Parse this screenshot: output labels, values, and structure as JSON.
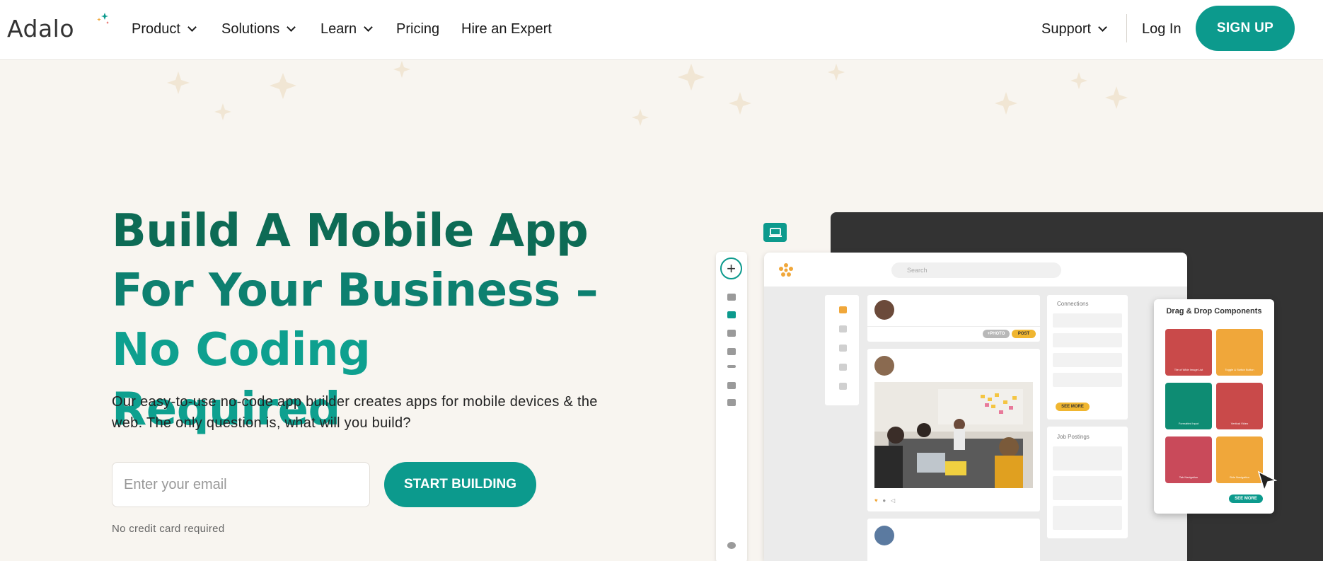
{
  "nav": {
    "logo": "Adalo",
    "items": [
      {
        "label": "Product",
        "dropdown": true
      },
      {
        "label": "Solutions",
        "dropdown": true
      },
      {
        "label": "Learn",
        "dropdown": true
      },
      {
        "label": "Pricing",
        "dropdown": false
      },
      {
        "label": "Hire an Expert",
        "dropdown": false
      }
    ],
    "support": "Support",
    "login": "Log In",
    "signup": "SIGN UP"
  },
  "hero": {
    "title_line1": "Build A Mobile App",
    "title_line2": "For Your Business –",
    "title_line3": "No Coding Required",
    "subtitle": "Our easy-to-use no-code app builder creates apps for mobile devices & the web. The only question is, what will you build?",
    "email_placeholder": "Enter your email",
    "cta": "START BUILDING",
    "note": "No credit card required"
  },
  "mockup": {
    "search_placeholder": "Search",
    "photo_pill": "+PHOTO",
    "post_pill": "POST",
    "connections": "Connections",
    "see_more": "SEE MORE",
    "job_postings": "Job Postings",
    "dnd_title": "Drag & Drop Components",
    "tiles": [
      {
        "label": "Tile of Wide Image List",
        "color": "#c94a4a"
      },
      {
        "label": "Toggle & Switch Button",
        "color": "#f0a73a"
      },
      {
        "label": "Formatted Input",
        "color": "#0e8c73"
      },
      {
        "label": "Vertical Video",
        "color": "#c94a4a"
      },
      {
        "label": "Tab Navigation",
        "color": "#c94a5a"
      },
      {
        "label": "Side Navigation",
        "color": "#f0a73a"
      }
    ],
    "dnd_see_more": "SEE MORE"
  },
  "colors": {
    "brand_teal": "#0c9a8d",
    "title_dark_green": "#0d6b55",
    "background": "#f8f5f0"
  }
}
